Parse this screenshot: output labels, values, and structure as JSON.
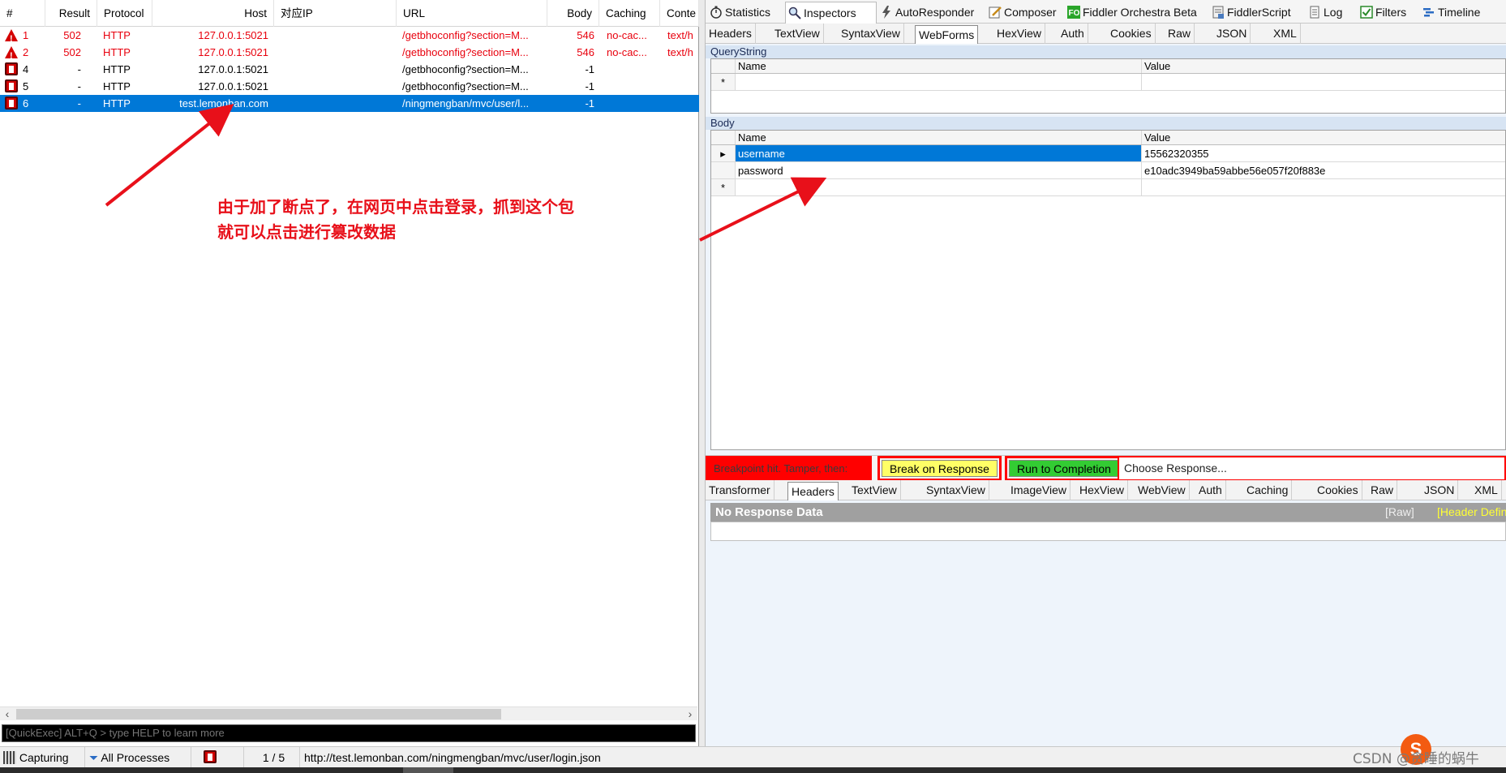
{
  "sessions": {
    "columns": [
      "#",
      "Result",
      "Protocol",
      "Host",
      "对应IP",
      "URL",
      "Body",
      "Caching",
      "Conte"
    ],
    "rows": [
      {
        "id": "1",
        "result": "502",
        "protocol": "HTTP",
        "host": "127.0.0.1:5021",
        "url": "/getbhoconfig?section=M...",
        "body": "546",
        "caching": "no-cac...",
        "content": "text/h",
        "icon": "warning-icon",
        "state": "error"
      },
      {
        "id": "2",
        "result": "502",
        "protocol": "HTTP",
        "host": "127.0.0.1:5021",
        "url": "/getbhoconfig?section=M...",
        "body": "546",
        "caching": "no-cac...",
        "content": "text/h",
        "icon": "warning-icon",
        "state": "error"
      },
      {
        "id": "4",
        "result": "-",
        "protocol": "HTTP",
        "host": "127.0.0.1:5021",
        "url": "/getbhoconfig?section=M...",
        "body": "-1",
        "caching": "",
        "content": "",
        "icon": "breakpoint-icon",
        "state": "normal"
      },
      {
        "id": "5",
        "result": "-",
        "protocol": "HTTP",
        "host": "127.0.0.1:5021",
        "url": "/getbhoconfig?section=M...",
        "body": "-1",
        "caching": "",
        "content": "",
        "icon": "breakpoint-icon",
        "state": "normal"
      },
      {
        "id": "6",
        "result": "-",
        "protocol": "HTTP",
        "host": "test.lemonban.com",
        "url": "/ningmengban/mvc/user/l...",
        "body": "-1",
        "caching": "",
        "content": "",
        "icon": "breakpoint-icon",
        "state": "selected"
      }
    ]
  },
  "annotation": {
    "line1": "由于加了断点了，在网页中点击登录，抓到这个包",
    "line2": "就可以点击进行篡改数据"
  },
  "quickexec": {
    "placeholder": "[QuickExec] ALT+Q > type HELP to learn more"
  },
  "top_tabs": [
    {
      "label": "Statistics",
      "icon": "stopwatch-icon"
    },
    {
      "label": "Inspectors",
      "icon": "magnifier-icon",
      "active": true
    },
    {
      "label": "AutoResponder",
      "icon": "lightning-icon"
    },
    {
      "label": "Composer",
      "icon": "pencil-icon"
    },
    {
      "label": "Fiddler Orchestra Beta",
      "icon": "fo-icon"
    },
    {
      "label": "FiddlerScript",
      "icon": "script-icon"
    },
    {
      "label": "Log",
      "icon": "log-icon"
    },
    {
      "label": "Filters",
      "icon": "checkbox-icon"
    },
    {
      "label": "Timeline",
      "icon": "timeline-icon"
    }
  ],
  "request_tabs": [
    "Headers",
    "TextView",
    "SyntaxView",
    "WebForms",
    "HexView",
    "Auth",
    "Cookies",
    "Raw",
    "JSON",
    "XML"
  ],
  "request_active": "WebForms",
  "querystring": {
    "title": "QueryString",
    "col_name": "Name",
    "col_value": "Value",
    "new_row_marker": "*"
  },
  "body": {
    "title": "Body",
    "col_name": "Name",
    "col_value": "Value",
    "rows": [
      {
        "name": "username",
        "value": "15562320355"
      },
      {
        "name": "password",
        "value": "e10adc3949ba59abbe56e057f20f883e"
      }
    ],
    "new_row_marker": "*"
  },
  "breakpoint_bar": {
    "label": "Breakpoint hit. Tamper, then:",
    "break_on_response": "Break on Response",
    "run_to_completion": "Run to Completion",
    "choose_response": "Choose Response...",
    "colors": {
      "label_bg": "#ff0000",
      "break_bg": "#ffff66",
      "run_bg": "#33cc33"
    }
  },
  "response_tabs": [
    "Transformer",
    "Headers",
    "TextView",
    "SyntaxView",
    "ImageView",
    "HexView",
    "WebView",
    "Auth",
    "Caching",
    "Cookies",
    "Raw",
    "JSON",
    "XML"
  ],
  "response_active": "Headers",
  "response": {
    "title": "No Response Data",
    "raw_link": "[Raw]",
    "header_definitions": "[Header Defin"
  },
  "statusbar": {
    "capturing": "Capturing",
    "processes": "All Processes",
    "count": "1 / 5",
    "url": "http://test.lemonban.com/ningmengban/mvc/user/login.json"
  },
  "watermark": {
    "text": "CSDN @贪睡的蜗牛",
    "logo": "S"
  }
}
